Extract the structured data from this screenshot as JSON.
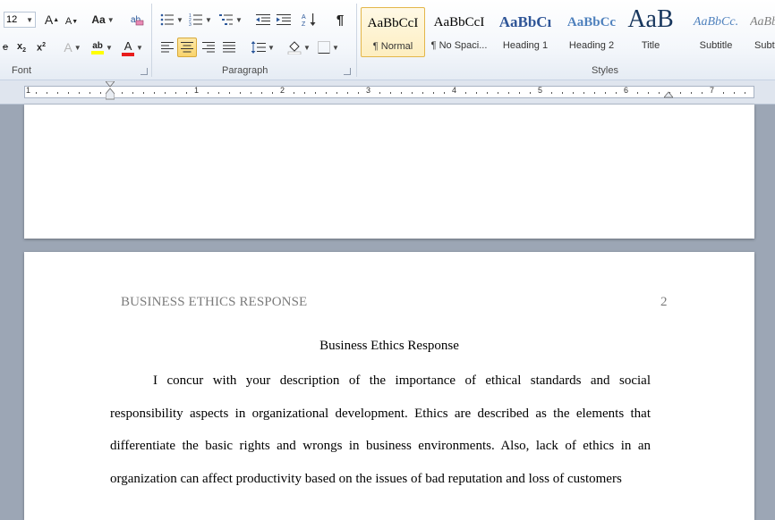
{
  "ribbon": {
    "font_size": "12",
    "groups": {
      "font": "Font",
      "paragraph": "Paragraph",
      "styles": "Styles"
    },
    "font_buttons": {
      "grow": "A",
      "shrink": "A",
      "change_case": "Aa",
      "clear": "A",
      "highlight": "ab",
      "font_color": "A"
    },
    "styles": [
      {
        "sample": "AaBbCcI",
        "name": "¶ Normal",
        "active": true
      },
      {
        "sample": "AaBbCcI",
        "name": "¶ No Spaci...",
        "active": false
      },
      {
        "sample": "AaBbCı",
        "name": "Heading 1",
        "active": false
      },
      {
        "sample": "AaBbCc",
        "name": "Heading 2",
        "active": false
      },
      {
        "sample": "AaB",
        "name": "Title",
        "active": false
      },
      {
        "sample": "AaBbCc.",
        "name": "Subtitle",
        "active": false
      },
      {
        "sample": "AaBbCcI",
        "name": "Subtl",
        "active": false
      }
    ]
  },
  "ruler": {
    "numbers": [
      "1",
      "1",
      "2",
      "3",
      "4",
      "5",
      "6",
      "7"
    ]
  },
  "document": {
    "header": "BUSINESS ETHICS RESPONSE",
    "page_number": "2",
    "title": "Business Ethics Response",
    "body": "I concur with your description of the importance of ethical standards and social responsibility aspects in organizational development. Ethics are described as the elements that differentiate the basic rights and wrongs in business environments. Also, lack of ethics in an organization can affect productivity based on the issues of bad reputation and loss of customers"
  },
  "colors": {
    "accent": "#2b579a",
    "selected": "#f9d36b",
    "page_bg": "#9ca6b5"
  }
}
